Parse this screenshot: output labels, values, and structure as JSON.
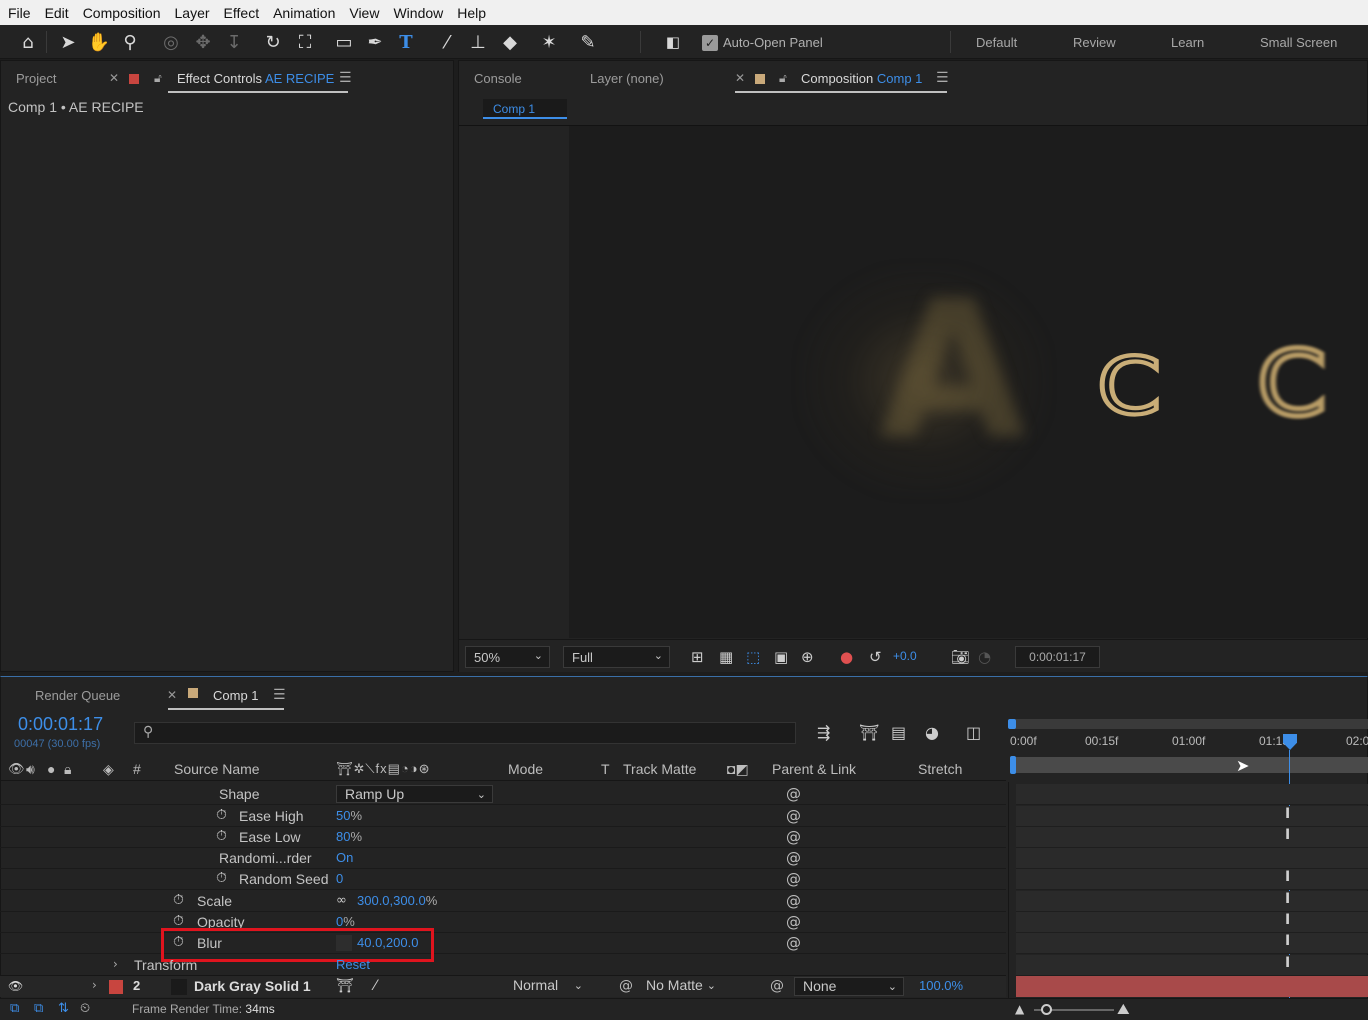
{
  "menu": [
    "File",
    "Edit",
    "Composition",
    "Layer",
    "Effect",
    "Animation",
    "View",
    "Window",
    "Help"
  ],
  "toolbar": {
    "auto_open_label": "Auto-Open Panel",
    "workspaces": [
      "Default",
      "Review",
      "Learn",
      "Small Screen"
    ]
  },
  "left_panel": {
    "tab_project": "Project",
    "tab_effect_controls": "Effect Controls",
    "tab_effect_controls_layer": "AE RECIPE",
    "breadcrumb": "Comp 1 • AE RECIPE"
  },
  "viewer": {
    "tab_console": "Console",
    "tab_layer": "Layer (none)",
    "tab_composition": "Composition",
    "tab_composition_name": "Comp 1",
    "subtab": "Comp 1",
    "zoom": "50%",
    "resolution": "Full",
    "exposure": "+0.0",
    "timecode": "0:00:01:17",
    "preview_letters": [
      "A",
      "C",
      "C"
    ]
  },
  "timeline": {
    "tab_render_queue": "Render Queue",
    "tab_comp": "Comp 1",
    "timecode": "0:00:01:17",
    "frame_info": "00047 (30.00 fps)",
    "search_placeholder": "",
    "columns": {
      "hash": "#",
      "source_name": "Source Name",
      "mode": "Mode",
      "t": "T",
      "track_matte": "Track Matte",
      "parent_link": "Parent & Link",
      "stretch": "Stretch"
    },
    "ruler": [
      "0:00f",
      "00:15f",
      "01:00f",
      "01:15f",
      "02:0"
    ],
    "properties": [
      {
        "name": "Shape",
        "value": "Ramp Up"
      },
      {
        "name": "Ease High",
        "value": "50",
        "unit": "%"
      },
      {
        "name": "Ease Low",
        "value": "80",
        "unit": "%"
      },
      {
        "name": "Randomi...rder",
        "value": "On"
      },
      {
        "name": "Random Seed",
        "value": "0"
      },
      {
        "name": "Scale",
        "value": "300.0,300.0",
        "unit": "%"
      },
      {
        "name": "Opacity",
        "value": "0",
        "unit": "%"
      },
      {
        "name": "Blur",
        "value": "40.0,200.0"
      }
    ],
    "transform": {
      "name": "Transform",
      "value": "Reset"
    },
    "layer": {
      "index": "2",
      "name": "Dark Gray Solid 1",
      "mode": "Normal",
      "track_matte": "No Matte",
      "parent": "None",
      "stretch": "100.0%"
    },
    "status_label": "Frame Render Time:",
    "status_value": "34ms"
  },
  "colors": {
    "accent": "#3d8ee8",
    "highlight_box": "#e0141e",
    "layer_bar": "#a84a4a",
    "label_red": "#c8453f",
    "label_tan": "#c9a97a"
  }
}
